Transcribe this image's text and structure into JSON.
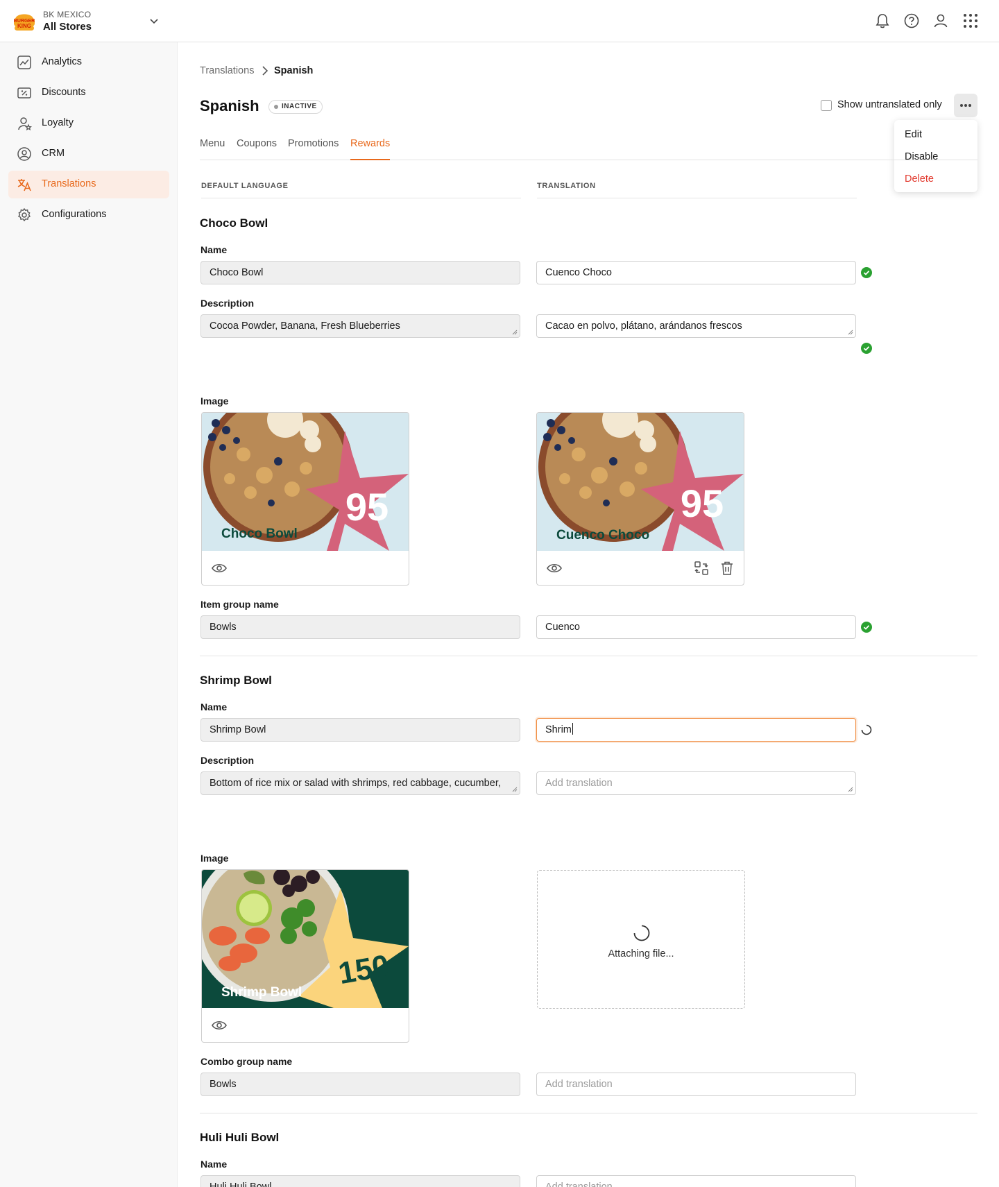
{
  "header": {
    "org": "BK MEXICO",
    "store": "All Stores",
    "icons": [
      "bell-icon",
      "help-icon",
      "user-icon",
      "apps-grid-icon"
    ]
  },
  "sidebar": {
    "items": [
      {
        "label": "Analytics",
        "icon": "analytics-icon"
      },
      {
        "label": "Discounts",
        "icon": "discounts-icon"
      },
      {
        "label": "Loyalty",
        "icon": "loyalty-icon"
      },
      {
        "label": "CRM",
        "icon": "crm-icon"
      },
      {
        "label": "Translations",
        "icon": "translations-icon",
        "active": true
      },
      {
        "label": "Configurations",
        "icon": "gear-icon"
      }
    ]
  },
  "breadcrumb": {
    "parent": "Translations",
    "current": "Spanish"
  },
  "page": {
    "title": "Spanish",
    "status": "INACTIVE",
    "show_untranslated_label": "Show untranslated only",
    "accent": "#e8691c"
  },
  "menu": {
    "items": [
      "Edit",
      "Disable",
      "Delete"
    ]
  },
  "tabs": [
    "Menu",
    "Coupons",
    "Promotions",
    "Rewards"
  ],
  "active_tab": "Rewards",
  "columns": {
    "default": "DEFAULT LANGUAGE",
    "translation": "TRANSLATION"
  },
  "rewards": [
    {
      "title": "Choco Bowl",
      "fields": {
        "name": {
          "label": "Name",
          "default": "Choco Bowl",
          "translation": "Cuenco Choco"
        },
        "description": {
          "label": "Description",
          "default": "Cocoa Powder, Banana, Fresh Blueberries",
          "translation": "Cacao en polvo, plátano, arándanos frescos"
        },
        "image": {
          "label": "Image",
          "default_caption": "Choco Bowl",
          "translation_caption": "Cuenco Choco",
          "points": "95"
        },
        "group": {
          "label": "Item group name",
          "default": "Bowls",
          "translation": "Cuenco"
        }
      }
    },
    {
      "title": "Shrimp Bowl",
      "fields": {
        "name": {
          "label": "Name",
          "default": "Shrimp Bowl",
          "translation": "Shrim"
        },
        "description": {
          "label": "Description",
          "default": "Bottom of rice mix or salad with shrimps, red cabbage, cucumber,",
          "placeholder": "Add translation"
        },
        "image": {
          "label": "Image",
          "default_caption": "Shrimp Bowl",
          "points": "150",
          "upload_status": "Attaching file..."
        },
        "group": {
          "label": "Combo group name",
          "default": "Bowls",
          "placeholder": "Add translation"
        }
      }
    },
    {
      "title": "Huli Huli Bowl",
      "fields": {
        "name": {
          "label": "Name",
          "default": "Huli Huli Bowl",
          "placeholder": "Add translation"
        }
      }
    }
  ]
}
